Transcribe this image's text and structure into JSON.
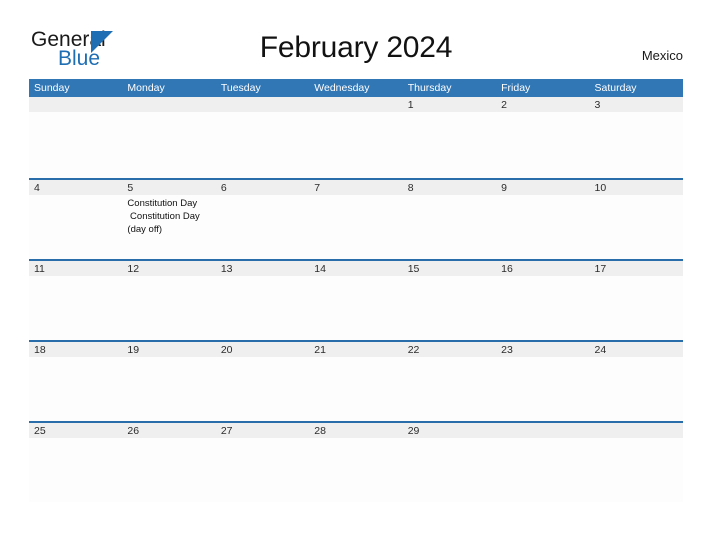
{
  "header": {
    "logo": {
      "word1": "General",
      "word2": "Blue",
      "triangle_icon": "logo-triangle-icon",
      "color_word1": "#1a1a1a",
      "color_word2": "#1f6eb4"
    },
    "title": "February 2024",
    "country": "Mexico"
  },
  "theme": {
    "header_blue": "#3176b5",
    "row_divider_blue": "#2a6dab",
    "date_band_gray": "#efefef",
    "cell_background": "#fdfdfd",
    "page_background": "#ffffff",
    "text_dark": "#1a1a1a"
  },
  "calendar": {
    "month": "February",
    "year": "2024",
    "weekday_headers": [
      "Sunday",
      "Monday",
      "Tuesday",
      "Wednesday",
      "Thursday",
      "Friday",
      "Saturday"
    ],
    "weeks": [
      [
        {
          "date": "",
          "events": []
        },
        {
          "date": "",
          "events": []
        },
        {
          "date": "",
          "events": []
        },
        {
          "date": "",
          "events": []
        },
        {
          "date": "1",
          "events": []
        },
        {
          "date": "2",
          "events": []
        },
        {
          "date": "3",
          "events": []
        }
      ],
      [
        {
          "date": "4",
          "events": []
        },
        {
          "date": "5",
          "events": [
            "Constitution Day",
            " Constitution Day",
            "(day off)"
          ]
        },
        {
          "date": "6",
          "events": []
        },
        {
          "date": "7",
          "events": []
        },
        {
          "date": "8",
          "events": []
        },
        {
          "date": "9",
          "events": []
        },
        {
          "date": "10",
          "events": []
        }
      ],
      [
        {
          "date": "11",
          "events": []
        },
        {
          "date": "12",
          "events": []
        },
        {
          "date": "13",
          "events": []
        },
        {
          "date": "14",
          "events": []
        },
        {
          "date": "15",
          "events": []
        },
        {
          "date": "16",
          "events": []
        },
        {
          "date": "17",
          "events": []
        }
      ],
      [
        {
          "date": "18",
          "events": []
        },
        {
          "date": "19",
          "events": []
        },
        {
          "date": "20",
          "events": []
        },
        {
          "date": "21",
          "events": []
        },
        {
          "date": "22",
          "events": []
        },
        {
          "date": "23",
          "events": []
        },
        {
          "date": "24",
          "events": []
        }
      ],
      [
        {
          "date": "25",
          "events": []
        },
        {
          "date": "26",
          "events": []
        },
        {
          "date": "27",
          "events": []
        },
        {
          "date": "28",
          "events": []
        },
        {
          "date": "29",
          "events": []
        },
        {
          "date": "",
          "events": []
        },
        {
          "date": "",
          "events": []
        }
      ]
    ]
  }
}
